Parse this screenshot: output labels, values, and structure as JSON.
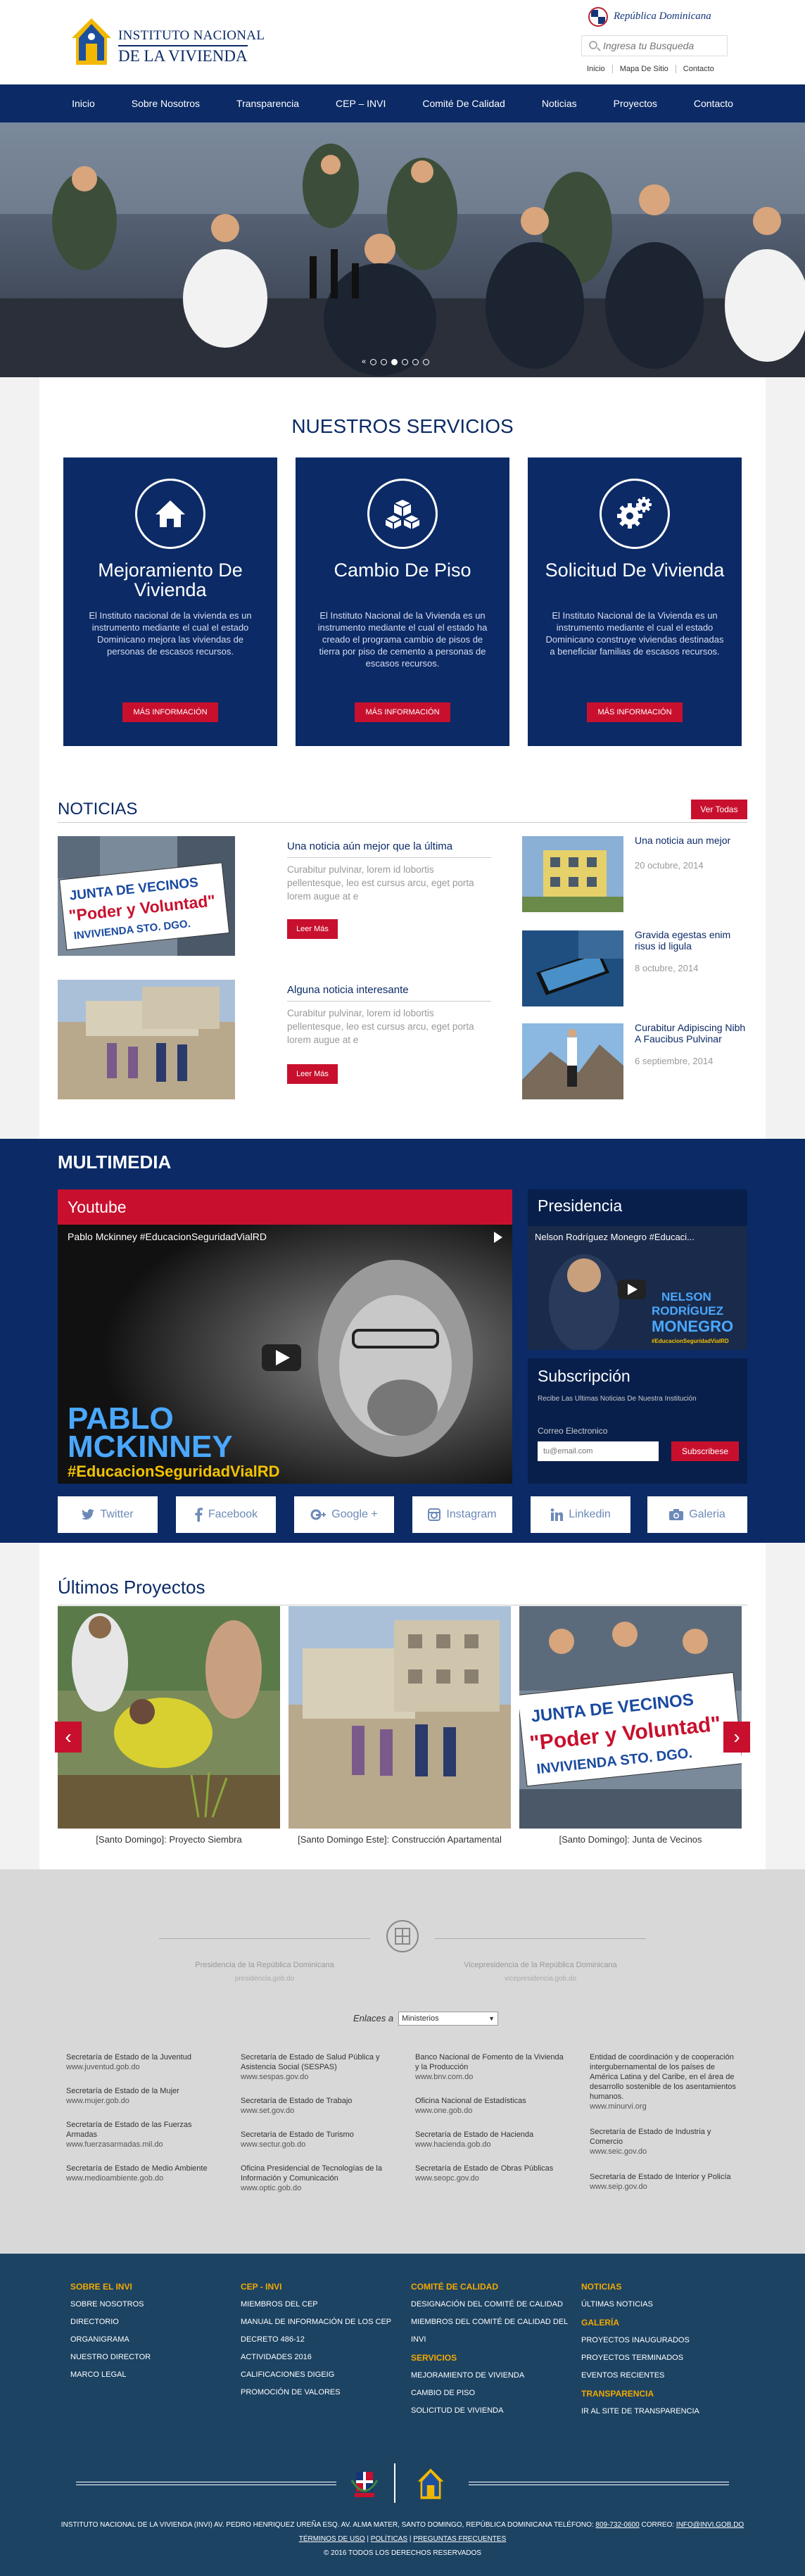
{
  "header": {
    "logo_line1": "INSTITUTO NACIONAL",
    "logo_line2": "DE LA VIVIENDA",
    "rd_text": "República Dominicana",
    "search_placeholder": "Ingresa tu Busqueda",
    "top_links": [
      "Inicio",
      "Mapa De Sitio",
      "Contacto"
    ]
  },
  "nav": [
    "Inicio",
    "Sobre Nosotros",
    "Transparencia",
    "CEP – INVI",
    "Comité De Calidad",
    "Noticias",
    "Proyectos",
    "Contacto"
  ],
  "hero": {
    "arrow": "«"
  },
  "services": {
    "title": "NUESTROS SERVICIOS",
    "items": [
      {
        "icon": "home-icon",
        "title": "Mejoramiento De Vivienda",
        "text": "El Instituto nacional de la vivienda es un instrumento mediante el cual el estado Dominicano mejora las viviendas de personas de escasos recursos.",
        "button": "MÁS INFORMACIÓN"
      },
      {
        "icon": "cubes-icon",
        "title": "Cambio De Piso",
        "text": "El Instituto Nacional de la Vivienda es un instrumento mediante el cual el estado ha creado el programa cambio de pisos de tierra por piso de cemento a personas de escasos recursos.",
        "button": "MÁS INFORMACIÓN"
      },
      {
        "icon": "gears-icon",
        "title": "Solicitud De Vivienda",
        "text": "El Instituto Nacional de la Vivienda es un instrumento mediante el cual el estado Dominicano construye viviendas destinadas a beneficiar familias de escasos recursos.",
        "button": "MÁS INFORMACIÓN"
      }
    ]
  },
  "news": {
    "title": "NOTICIAS",
    "all_button": "Ver Todas",
    "main": [
      {
        "title": "Una noticia aún mejor que la última",
        "text": "Curabitur pulvinar, lorem id lobortis pellentesque, leo est cursus arcu, eget porta lorem augue at e",
        "button": "Leer Más",
        "img_sign1": "JUNTA DE VECINOS",
        "img_sign2": "\"Poder y Voluntad\"",
        "img_sign3": "INVIVIENDA STO. DGO."
      },
      {
        "title": "Alguna noticia interesante",
        "text": "Curabitur pulvinar, lorem id lobortis pellentesque, leo est cursus arcu, eget porta lorem augue at e",
        "button": "Leer Más"
      }
    ],
    "side": [
      {
        "title": "Una noticia aun mejor",
        "date": "20 octubre, 2014"
      },
      {
        "title": "Gravida egestas enim risus id ligula",
        "date": "8 octubre, 2014"
      },
      {
        "title": "Curabitur Adipiscing Nibh A Faucibus Pulvinar",
        "date": "6 septiembre, 2014"
      }
    ]
  },
  "multimedia": {
    "title": "MULTIMEDIA",
    "youtube": {
      "header": "Youtube",
      "video_title": "Pablo Mckinney #EducacionSeguridadVialRD",
      "name1": "PABLO",
      "name2": "MCKINNEY",
      "hashtag": "#EducacionSeguridadVialRD"
    },
    "presidencia": {
      "header": "Presidencia",
      "video_title": "Nelson Rodríguez Monegro #Educaci...",
      "name1": "NELSON",
      "name2": "RODRÍGUEZ",
      "name3": "MONEGRO",
      "hashtag": "#EducacionSeguridadVialRD"
    },
    "subscription": {
      "header": "Subscripción",
      "desc": "Recibe Las Ultimas Noticias De Nuestra Institución",
      "label": "Correo Electronico",
      "placeholder": "tu@email.com",
      "button": "Subscribese"
    },
    "social": [
      "Twitter",
      "Facebook",
      "Google +",
      "Instagram",
      "Linkedin",
      "Galeria"
    ]
  },
  "projects": {
    "title": "Últimos Proyectos",
    "items": [
      "[Santo Domingo]: Proyecto Siembra",
      "[Santo Domingo Este]: Construcción Apartamental",
      "[Santo Domingo]: Junta de Vecinos"
    ],
    "sign1": "JUNTA DE VECINOS",
    "sign2": "\"Poder y Voluntad\"",
    "sign3": "INVIVIENDA STO. DGO.",
    "prev": "‹",
    "next": "›"
  },
  "gov": {
    "pres_name": "Presidencia de la República Dominicana",
    "pres_url": "presidencia.gob.do",
    "vice_name": "Vicepresidencia de la República Dominicana",
    "vice_url": "vicepresidencia.gob.do",
    "enlaces_label": "Enlaces a",
    "enlaces_value": "Ministerios",
    "cols": [
      [
        {
          "n": "Secretaría de Estado de la Juventud",
          "u": "www.juventud.gob.do"
        },
        {
          "n": "Secretaría de Estado de la Mujer",
          "u": "www.mujer.gob.do"
        },
        {
          "n": "Secretaría de Estado de las Fuerzas Armadas",
          "u": "www.fuerzasarmadas.mil.do"
        },
        {
          "n": "Secretaría de Estado de Medio Ambiente",
          "u": "www.medioambiente.gob.do"
        }
      ],
      [
        {
          "n": "Secretaría de Estado de Salud Pública y Asistencia Social (SESPAS)",
          "u": "www.sespas.gov.do"
        },
        {
          "n": "Secretaría de Estado de Trabajo",
          "u": "www.set.gov.do"
        },
        {
          "n": "Secretaría de Estado de Turismo",
          "u": "www.sectur.gob.do"
        },
        {
          "n": "Oficina Presidencial de Tecnologías de la Información y Comunicación",
          "u": "www.optic.gob.do"
        }
      ],
      [
        {
          "n": "Banco Nacional de Fomento de la Vivienda y la Producción",
          "u": "www.bnv.com.do"
        },
        {
          "n": "Oficina Nacional de Estadísticas",
          "u": "www.one.gob.do"
        },
        {
          "n": "Secretaría de Estado de Hacienda",
          "u": "www.hacienda.gob.do"
        },
        {
          "n": "Secretaría de Estado de Obras Públicas",
          "u": "www.seopc.gov.do"
        }
      ],
      [
        {
          "n": "Entidad de coordinación y de cooperación intergubernamental de los países de América Latina y del Caribe, en el área de desarrollo sostenible de los asentamientos humanos.",
          "u": "www.minurvi.org"
        },
        {
          "n": "Secretaría de Estado de Industria y Comercio",
          "u": "www.seic.gov.do"
        },
        {
          "n": "Secretaría de Estado de Interior y Policía",
          "u": "www.seip.gov.do"
        }
      ]
    ]
  },
  "footer": {
    "cols": [
      {
        "h": "SOBRE EL INVI",
        "items": [
          "SOBRE NOSOTROS",
          "DIRECTORIO",
          "ORGANIGRAMA",
          "NUESTRO DIRECTOR",
          "MARCO LEGAL"
        ]
      },
      {
        "h": "CEP - INVI",
        "items": [
          "MIEMBROS DEL CEP",
          "MANUAL DE INFORMACIÓN DE LOS CEP",
          "DECRETO 486-12",
          "ACTIVIDADES 2016",
          "CALIFICACIONES DIGEIG",
          "PROMOCIÓN DE VALORES"
        ]
      },
      {
        "h": "COMITÉ DE CALIDAD",
        "items": [
          "DESIGNACIÓN DEL COMITÉ DE CALIDAD",
          "MIEMBROS DEL COMITÉ DE CALIDAD DEL INVI"
        ],
        "h2": "SERVICIOS",
        "items2": [
          "MEJORAMIENTO DE VIVIENDA",
          "CAMBIO DE PISO",
          "SOLICITUD DE VIVIENDA"
        ]
      },
      {
        "h": "NOTICIAS",
        "items": [
          "ÚLTIMAS NOTICIAS"
        ],
        "h2": "GALERÍA",
        "items2": [
          "PROYECTOS INAUGURADOS",
          "PROYECTOS TERMINADOS",
          "EVENTOS RECIENTES"
        ],
        "h3": "TRANSPARENCIA",
        "items3": [
          "IR AL SITE DE TRANSPARENCIA"
        ]
      }
    ],
    "address": "INSTITUTO NACIONAL DE LA VIVIENDA (INVI) AV. PEDRO HENRIQUEZ UREÑA ESQ. AV. ALMA MATER, SANTO DOMINGO, REPÚBLICA DOMINICANA TELÉFONO:",
    "phone": "809-732-0600",
    "email_label": "CORREO:",
    "email": "INFO@INVI.GOB.DO",
    "terms": "TÉRMINOS DE USO",
    "politicas": "POLÍTICAS",
    "preguntas": "PREGUNTAS FRECUENTES",
    "copyright": "© 2016 TODOS LOS DERECHOS RESERVADOS"
  },
  "colors": {
    "navy": "#0b2a66",
    "red": "#c8102e",
    "footer": "#1d4363",
    "gold": "#f2a900"
  }
}
